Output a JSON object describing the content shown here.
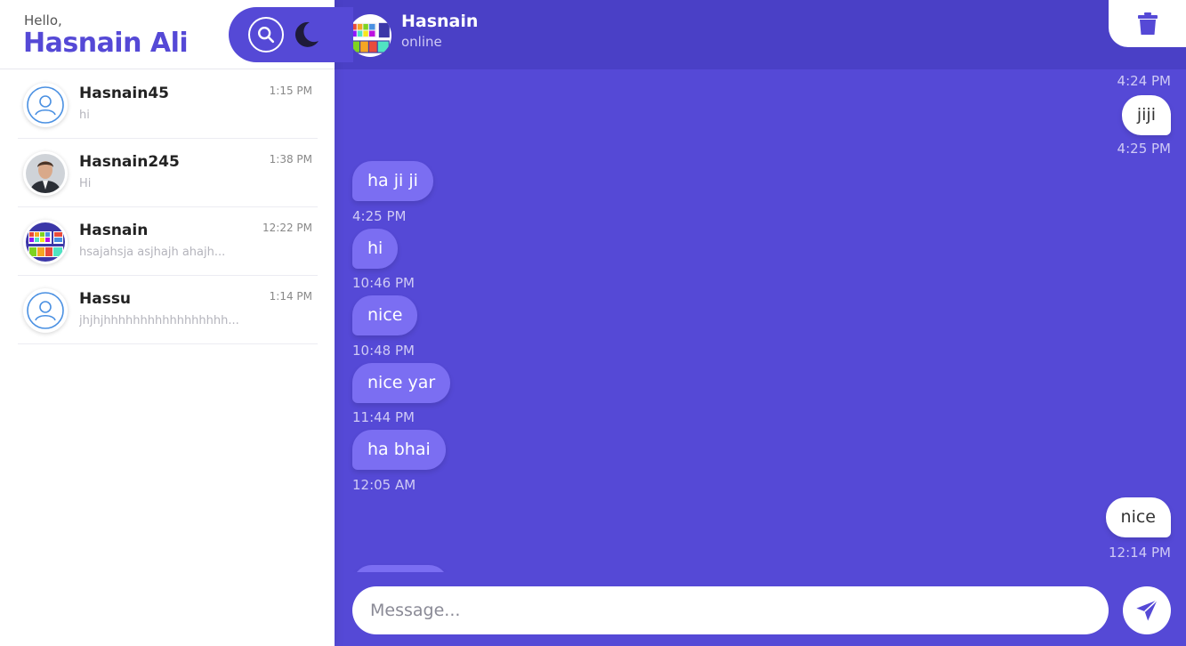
{
  "sidebar": {
    "greeting": "Hello,",
    "user_name": "Hasnain Ali",
    "chats": [
      {
        "name": "Hasnain45",
        "time": "1:15 PM",
        "preview": "hi",
        "avatar": "default-user-icon"
      },
      {
        "name": "Hasnain245",
        "time": "1:38 PM",
        "preview": "Hi",
        "avatar": "man-portrait-photo"
      },
      {
        "name": "Hasnain",
        "time": "12:22 PM",
        "preview": "hsajahsja asjhajh ahajh...",
        "avatar": "color-palette-image"
      },
      {
        "name": "Hassu",
        "time": "1:14 PM",
        "preview": "jhjhjhhhhhhhhhhhhhhhhh...",
        "avatar": "default-user-icon"
      }
    ]
  },
  "chat": {
    "header": {
      "name": "Hasnain",
      "status": "online"
    },
    "messages": [
      {
        "direction": "out",
        "text": "",
        "time": "4:24 PM"
      },
      {
        "direction": "out",
        "text": "jiji",
        "time": "4:25 PM"
      },
      {
        "direction": "in",
        "text": "ha ji ji",
        "time": "4:25 PM"
      },
      {
        "direction": "in",
        "text": "hi",
        "time": "10:46 PM"
      },
      {
        "direction": "in",
        "text": "nice",
        "time": "10:48 PM"
      },
      {
        "direction": "in",
        "text": "nice yar",
        "time": "11:44 PM"
      },
      {
        "direction": "in",
        "text": "ha bhai",
        "time": "12:05 AM"
      },
      {
        "direction": "out",
        "text": "nice",
        "time": "12:14 PM"
      }
    ],
    "composer": {
      "placeholder": "Message..."
    }
  },
  "colors": {
    "primary": "#5549d6",
    "header": "#4a40c6",
    "incoming_bubble": "#7b6ef2",
    "outgoing_bubble": "#ffffff"
  },
  "icons": [
    "search-icon",
    "moon-icon",
    "trash-icon",
    "send-icon",
    "default-user-icon"
  ]
}
